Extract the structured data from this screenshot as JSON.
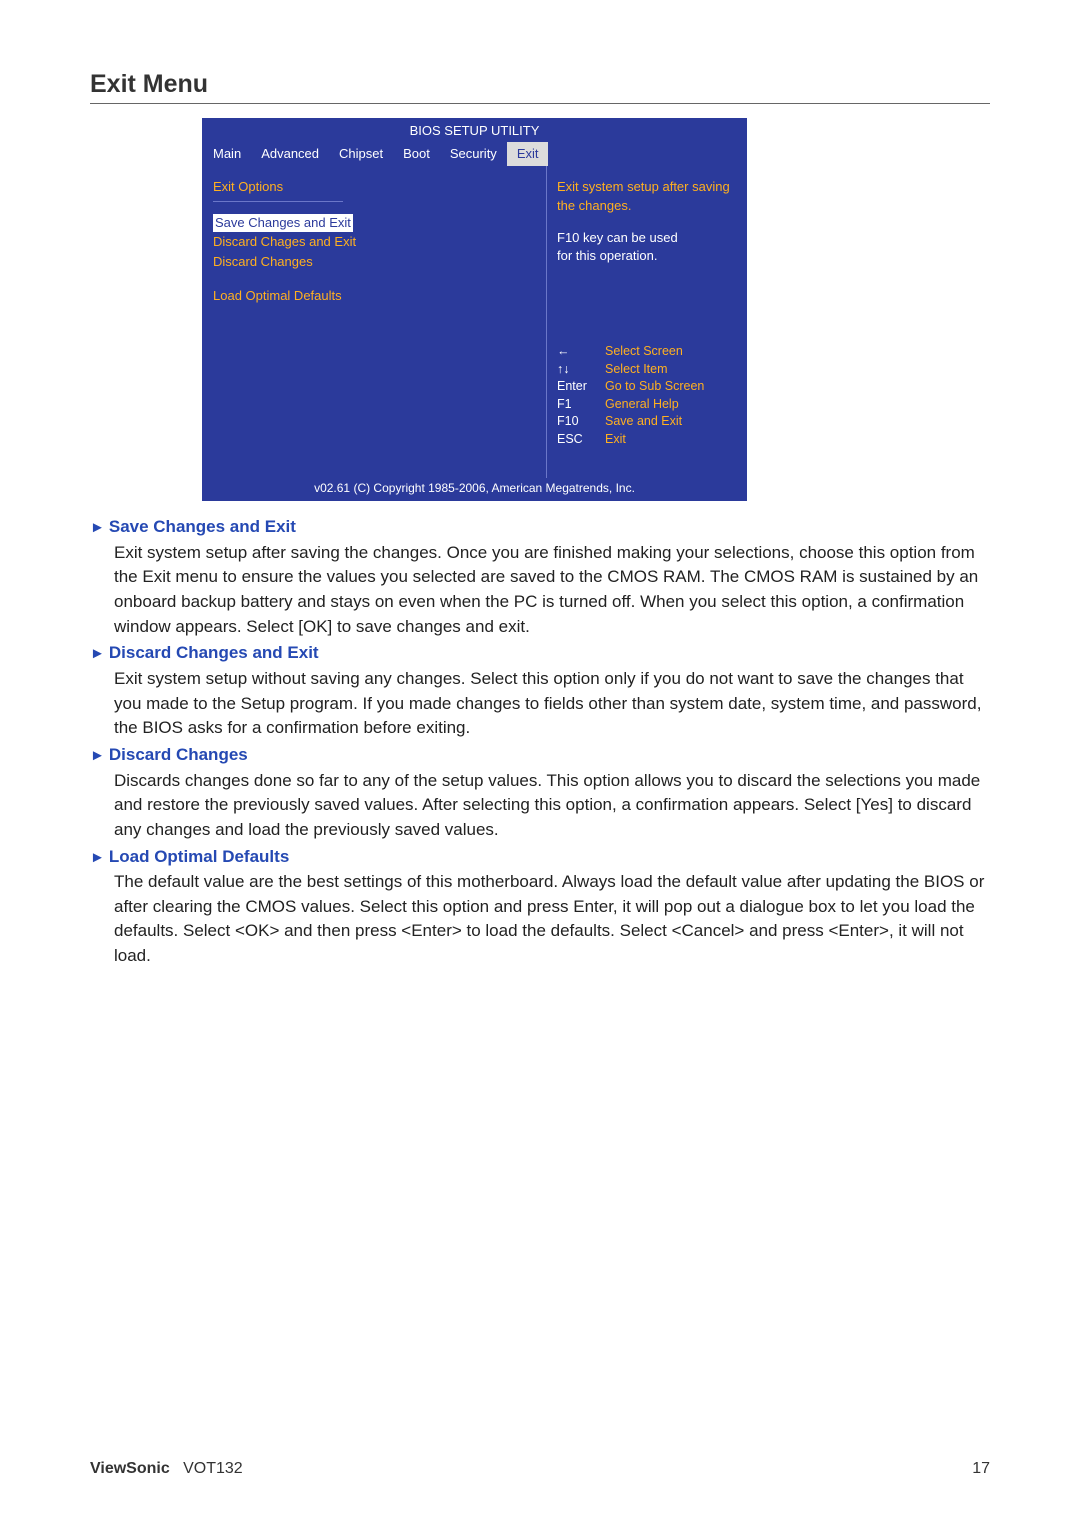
{
  "page": {
    "title": "Exit Menu"
  },
  "bios": {
    "title": "BIOS SETUP UTILITY",
    "tabs": [
      "Main",
      "Advanced",
      "Chipset",
      "Boot",
      "Security",
      "Exit"
    ],
    "left_section_title": "Exit Options",
    "options": [
      "Save Changes and Exit",
      "Discard Chages and Exit",
      "Discard Changes",
      "Load Optimal Defaults"
    ],
    "help_line1": "Exit system setup after saving",
    "help_line2": "the changes.",
    "help_line3": "F10 key can be used",
    "help_line4": "for this operation.",
    "nav": [
      {
        "key": "←",
        "act": "Select Screen"
      },
      {
        "key": "↑↓",
        "act": "Select Item"
      },
      {
        "key": "Enter",
        "act": "Go to Sub Screen"
      },
      {
        "key": "F1",
        "act": "General Help"
      },
      {
        "key": "F10",
        "act": "Save and Exit"
      },
      {
        "key": "ESC",
        "act": "Exit"
      }
    ],
    "footer": "v02.61 (C) Copyright 1985-2006, American Megatrends, Inc."
  },
  "desc": {
    "arrow": "►",
    "items": [
      {
        "title": " Save Changes and Exit",
        "body": "Exit system setup after saving the changes. Once you are finished making your selections, choose this option from the Exit menu to ensure the values you selected are saved to the CMOS RAM. The CMOS RAM is sustained by an onboard backup battery and stays on even when the PC is turned off. When you select this option, a confirmation window appears. Select [OK] to save changes and exit."
      },
      {
        "title": " Discard Changes and Exit",
        "body": "Exit system setup without saving any changes. Select this option only if you do not want to save the changes that you made to the Setup program. If you made changes to fields other than system date, system time, and password, the BIOS asks for a confirmation before exiting."
      },
      {
        "title": "Discard Changes",
        "body": "Discards changes done so far to any of the setup values. This option allows you to discard the selections you made and restore the previously saved values. After selecting this option, a confirmation appears. Select [Yes] to discard any changes and load the previously saved values."
      },
      {
        "title": "Load Optimal Defaults",
        "body": "The default value are the best settings of this motherboard. Always load the default value after updating the BIOS or after clearing the CMOS values. Select this option and press Enter, it will pop out a dialogue box to let you load the defaults. Select <OK> and then press <Enter> to load the defaults. Select <Cancel> and press <Enter>, it will not load."
      }
    ]
  },
  "footer": {
    "brand": "ViewSonic",
    "model": "VOT132",
    "page": "17"
  }
}
